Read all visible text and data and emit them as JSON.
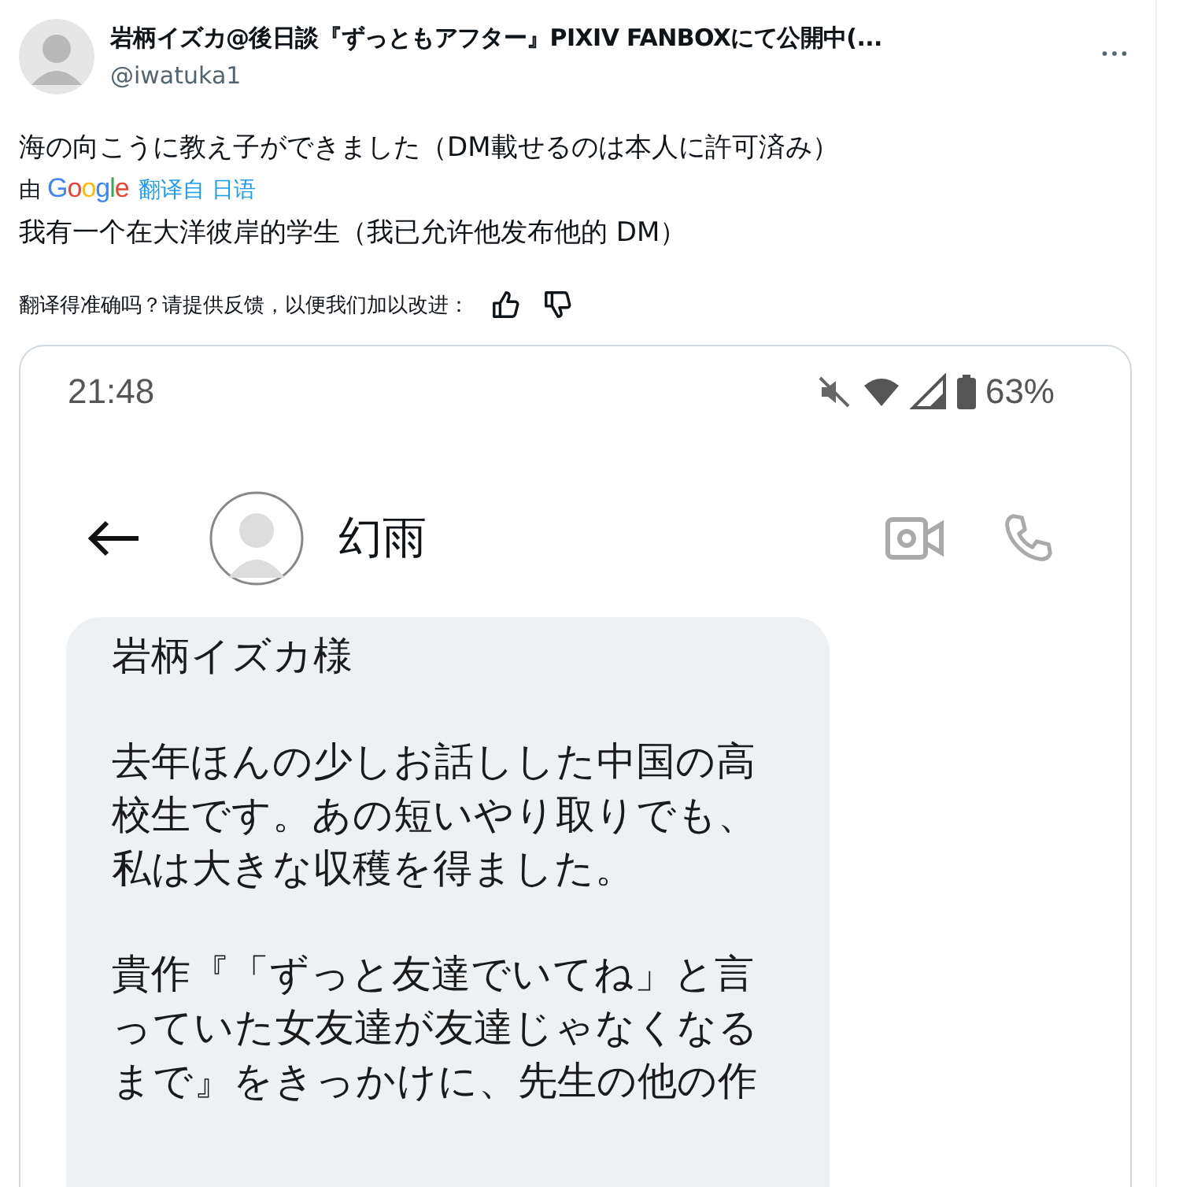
{
  "author": {
    "name": "岩柄イズカ@後日談『ずっともアフター』PIXIV FANBOXにて公開中(...",
    "handle": "@iwatuka1"
  },
  "tweet": {
    "text": "海の向こうに教え子ができました（DM載せるのは本人に許可済み）"
  },
  "translation": {
    "by": "由",
    "provider": "Google",
    "link": "翻译自 日语",
    "text": "我有一个在大洋彼岸的学生（我已允许他发布他的 DM）",
    "feedback": "翻译得准确吗？请提供反馈，以便我们加以改进："
  },
  "phone": {
    "time": "21:48",
    "battery": "63%",
    "contact": "幻雨",
    "message": [
      [
        "岩柄イズカ様"
      ],
      [
        "去年ほんの少しお話しした中国の高",
        "校生です。あの短いやり取りでも、",
        "私は大きな収穫を得ました。"
      ],
      [
        "貴作『「ずっと友達でいてね」と言",
        "っていた女友達が友達じゃなくなる",
        "まで』をきっかけに、先生の他の作"
      ]
    ]
  }
}
